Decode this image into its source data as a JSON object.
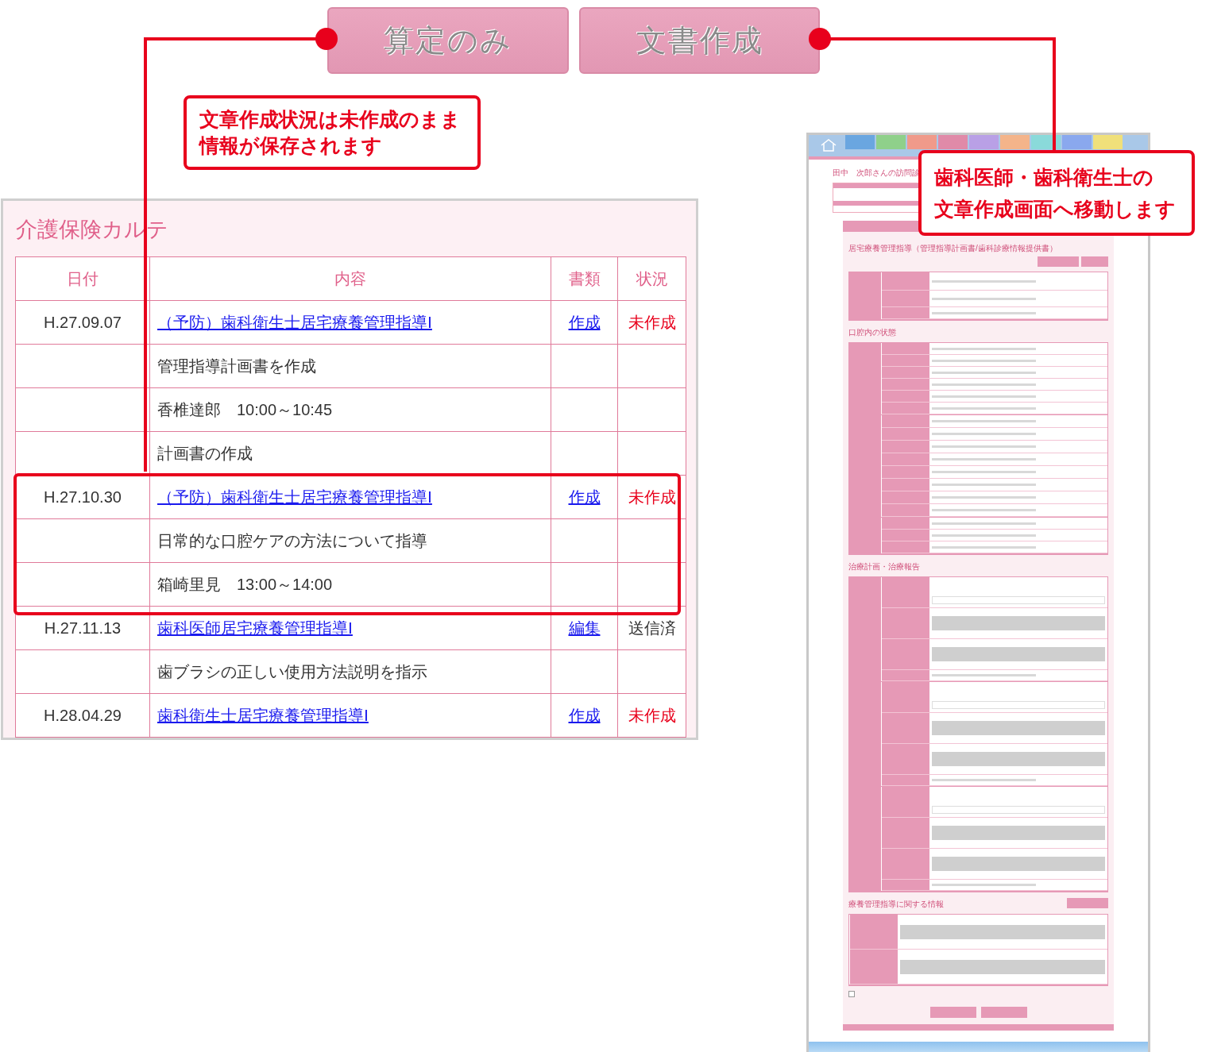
{
  "buttons": [
    {
      "label": "算定のみ"
    },
    {
      "label": "文書作成"
    }
  ],
  "callouts": [
    {
      "lines": [
        "文章作成状況は未作成のまま",
        "情報が保存されます"
      ]
    },
    {
      "lines": [
        "歯科医師・歯科衛生士の",
        "文章作成画面へ移動します"
      ]
    }
  ],
  "karte": {
    "title": "介護保険カルテ",
    "columns": [
      "日付",
      "内容",
      "書類",
      "状況"
    ],
    "entries": [
      {
        "date": "H.27.09.07",
        "title": "（予防）歯科衛生士居宅療養管理指導Ⅰ",
        "document": "作成",
        "status": "未作成",
        "sent": false,
        "highlighted": false,
        "notes": [
          "管理指導計画書を作成",
          "香椎達郎　10:00～10:45",
          "計画書の作成"
        ]
      },
      {
        "date": "H.27.10.30",
        "title": "（予防）歯科衛生士居宅療養管理指導Ⅰ",
        "document": "作成",
        "status": "未作成",
        "sent": false,
        "highlighted": true,
        "notes": [
          "日常的な口腔ケアの方法について指導",
          "箱崎里見　13:00～14:00"
        ]
      },
      {
        "date": "H.27.11.13",
        "title": "歯科医師居宅療養管理指導Ⅰ",
        "document": "編集",
        "status": "送信済",
        "sent": true,
        "highlighted": false,
        "notes": [
          "歯ブラシの正しい使用方法説明を指示"
        ]
      },
      {
        "date": "H.28.04.29",
        "title": "歯科衛生士居宅療養管理指導Ⅰ",
        "document": "作成",
        "status": "未作成",
        "sent": false,
        "highlighted": false
      }
    ]
  },
  "form_preview": {
    "patient_title": "田中　次郎さんの訪問診",
    "heading": "居宅療養管理指導（管理指導計画書/歯科診療情報提供書）",
    "sections": [
      "口腔内の状態",
      "治療計画・治療報告",
      "療養管理指導に関する情報"
    ],
    "checkbox_checked": false
  }
}
